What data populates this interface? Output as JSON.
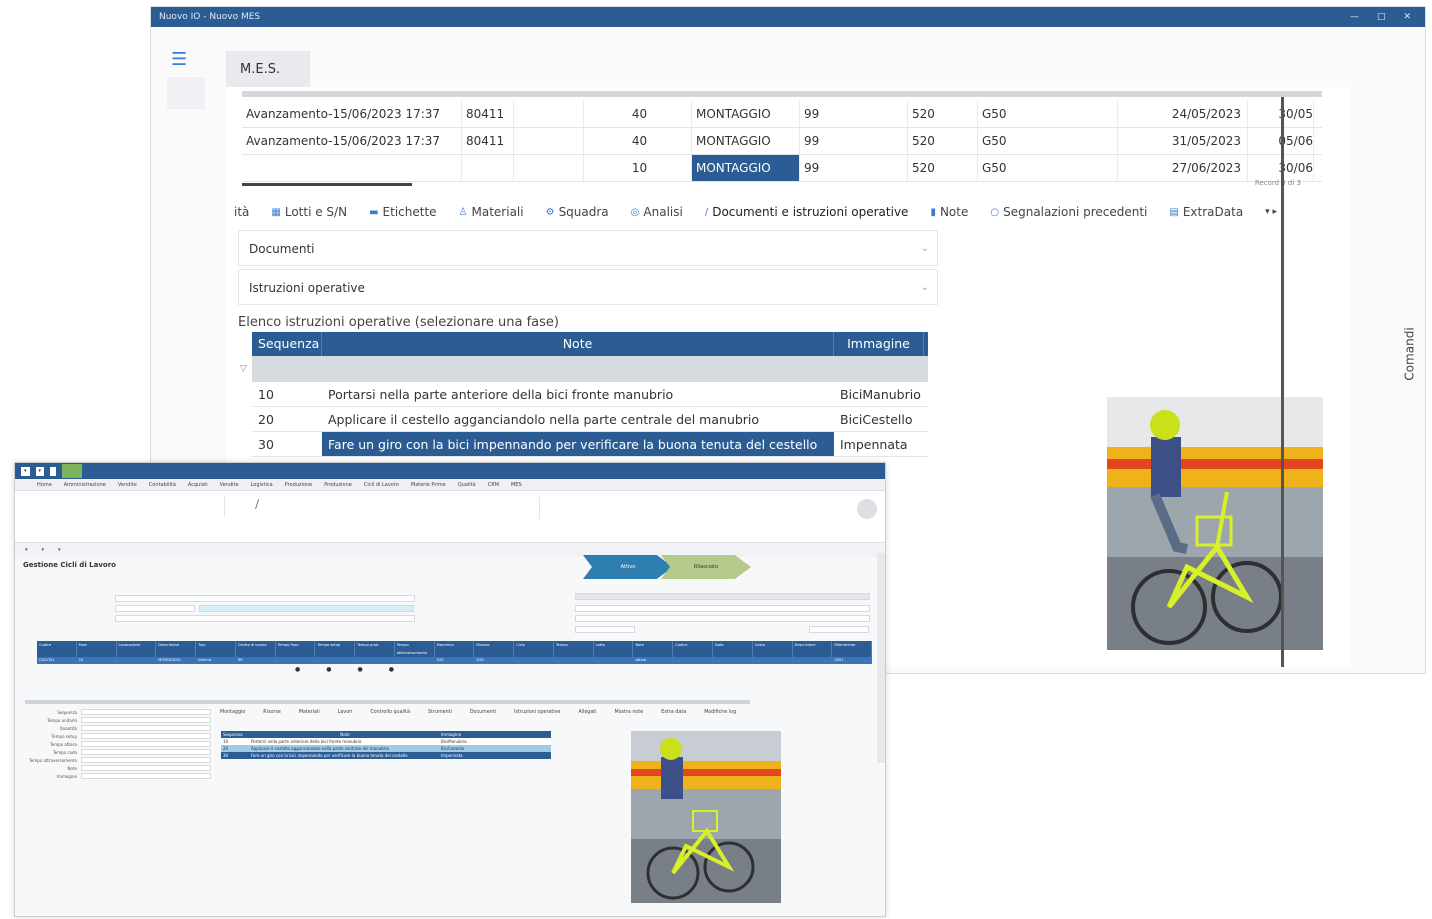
{
  "mes": {
    "title": "Nuovo IO - Nuovo MES",
    "window_controls": [
      "—",
      "□",
      "✕"
    ],
    "tab_label": "M.E.S.",
    "grid_rows": [
      [
        "Avanzamento-15/06/2023 17:37",
        "80411",
        "",
        "40",
        "MONTAGGIO",
        "99",
        "520",
        "G50",
        "24/05/2023",
        "30/05"
      ],
      [
        "Avanzamento-15/06/2023 17:37",
        "80411",
        "",
        "40",
        "MONTAGGIO",
        "99",
        "520",
        "G50",
        "31/05/2023",
        "05/06"
      ],
      [
        "",
        "",
        "",
        "10",
        "MONTAGGIO",
        "99",
        "520",
        "G50",
        "27/06/2023",
        "30/06"
      ]
    ],
    "grid_footer": "Record 3 di 3",
    "comandi_label": "Comandi",
    "tabs": [
      {
        "label": "ità",
        "icon": ""
      },
      {
        "label": "Lotti e S/N",
        "icon": "▦"
      },
      {
        "label": "Etichette",
        "icon": "▬"
      },
      {
        "label": "Materiali",
        "icon": "♙"
      },
      {
        "label": "Squadra",
        "icon": "⚙"
      },
      {
        "label": "Analisi",
        "icon": "◎"
      },
      {
        "label": "Documenti e istruzioni operative",
        "icon": "∕"
      },
      {
        "label": "Note",
        "icon": "▮"
      },
      {
        "label": "Segnalazioni precedenti",
        "icon": "○"
      },
      {
        "label": "ExtraData",
        "icon": "▤"
      }
    ],
    "tabs_more": "▾ ▸",
    "accordion_documenti": "Documenti",
    "accordion_istruzioni": "Istruzioni operative",
    "elenco_label": "Elenco istruzioni operative (selezionare una fase)",
    "istr_headers": [
      "Sequenza",
      "Note",
      "Immagine"
    ],
    "istr_rows": [
      {
        "seq": "10",
        "note": "Portarsi nella parte anteriore della bici fronte manubrio",
        "img": "BiciManubrio"
      },
      {
        "seq": "20",
        "note": "Applicare il cestello agganciandolo nella parte centrale del manubrio",
        "img": "BiciCestello"
      },
      {
        "seq": "30",
        "note": "Fare un giro con la bici impennando per verificare la buona tenuta del cestello",
        "img": "Impennata"
      }
    ]
  },
  "erp": {
    "form_title": "Gestione Cicli di Lavoro",
    "workflow": [
      "Attivo",
      "Rilasciato"
    ],
    "menu": [
      "Home",
      "Amministrazione",
      "Vendite",
      "Contabilità",
      "Acquisti",
      "Vendite",
      "Logistica",
      "Produzione",
      "Produzione",
      "Cicli di Lavoro",
      "Materie Prime",
      "Qualità",
      "CRM",
      "MES"
    ],
    "grid_headers": [
      "Codice",
      "Fase",
      "Lavorazione",
      "Descrizione",
      "Tipo",
      "Centro di lavoro",
      "Tempo Fase",
      "Tempo setup",
      "Tempo prod.",
      "Tempo attraversamento",
      "Macchina",
      "Risorse",
      "Ciclo",
      "Tempo",
      "Lotto",
      "Note",
      "Codice",
      "Data",
      "Costo",
      "Descrizione",
      "Riferimento"
    ],
    "grid_row": [
      "CICLO01",
      "10",
      "",
      "MONTAGGIO",
      "Interna",
      "99",
      "",
      "",
      "",
      "",
      "520",
      "G50",
      "",
      "",
      "",
      "Attivo",
      "",
      "",
      "",
      "",
      "0001"
    ],
    "tabs": [
      "Montaggio",
      "Risorse",
      "Materiali",
      "Lavori",
      "Controllo qualità",
      "Strumenti",
      "Documenti",
      "Istruzioni operative",
      "Allegati",
      "Mostra note",
      "Extra data",
      "Modifiche log"
    ],
    "left_fields": [
      "Sequenza",
      "Tempo unitario",
      "Quantità",
      "Tempo setup",
      "Tempo attesa",
      "Tempo coda",
      "Tempo attraversamento",
      "Note",
      "Immagine"
    ],
    "istr_headers": [
      "Sequenza",
      "Note",
      "Immagine"
    ]
  }
}
